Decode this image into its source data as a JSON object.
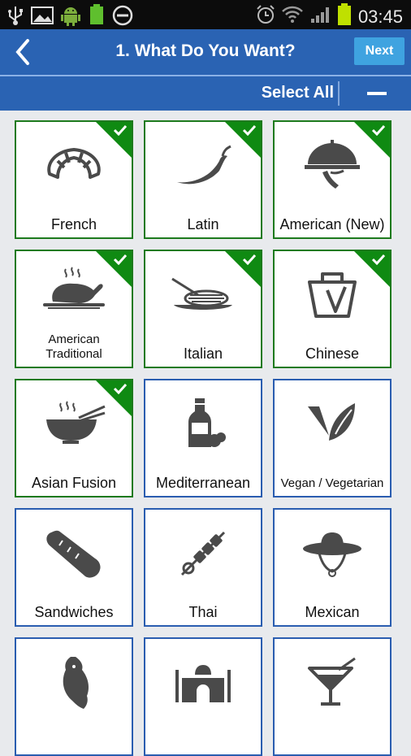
{
  "status_bar": {
    "time": "03:45",
    "battery_level": "100%"
  },
  "header": {
    "title": "1. What Do You Want?",
    "next_label": "Next"
  },
  "toolbar": {
    "select_all_label": "Select All"
  },
  "colors": {
    "primary_blue": "#2a63b3",
    "next_button": "#3fa3e0",
    "selected_green": "#0f8a12"
  },
  "cuisines": [
    {
      "label": "French",
      "icon": "croissant-icon",
      "selected": true
    },
    {
      "label": "Latin",
      "icon": "chili-pepper-icon",
      "selected": true
    },
    {
      "label": "American (New)",
      "icon": "cloche-icon",
      "selected": true
    },
    {
      "label": "American Traditional",
      "icon": "roast-turkey-icon",
      "selected": true
    },
    {
      "label": "Italian",
      "icon": "spaghetti-plate-icon",
      "selected": true
    },
    {
      "label": "Chinese",
      "icon": "takeout-box-icon",
      "selected": true
    },
    {
      "label": "Asian Fusion",
      "icon": "noodle-bowl-icon",
      "selected": true
    },
    {
      "label": "Mediterranean",
      "icon": "oil-bottle-olive-icon",
      "selected": false
    },
    {
      "label": "Vegan / Vegetarian",
      "icon": "leaf-v-icon",
      "selected": false
    },
    {
      "label": "Sandwiches",
      "icon": "bread-loaf-icon",
      "selected": false
    },
    {
      "label": "Thai",
      "icon": "skewer-icon",
      "selected": false
    },
    {
      "label": "Mexican",
      "icon": "sombrero-icon",
      "selected": false
    },
    {
      "label": "",
      "icon": "fish-icon",
      "selected": false
    },
    {
      "label": "",
      "icon": "taj-mahal-icon",
      "selected": false
    },
    {
      "label": "",
      "icon": "cocktail-icon",
      "selected": false
    }
  ]
}
